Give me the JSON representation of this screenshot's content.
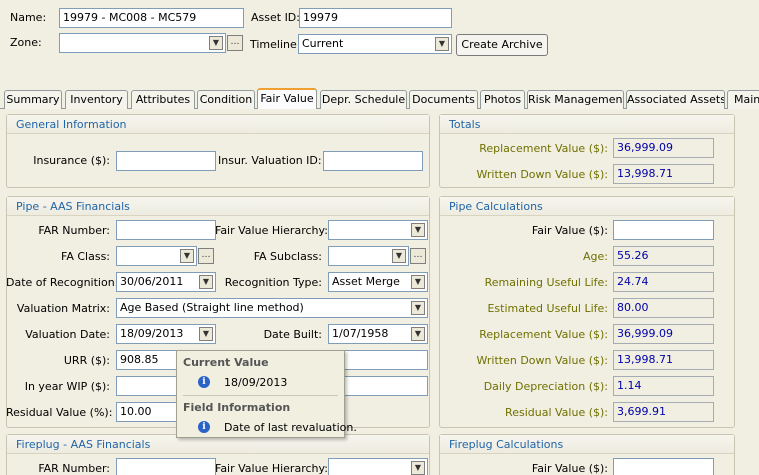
{
  "header": {
    "name_label": "Name:",
    "name_value": "19979 - MC008 - MC579",
    "asset_id_label": "Asset ID:",
    "asset_id_value": "19979",
    "zone_label": "Zone:",
    "zone_value": "",
    "timeline_label": "Timeline:",
    "timeline_value": "Current",
    "create_archive_label": "Create Archive"
  },
  "tabs": [
    {
      "label": "Summary"
    },
    {
      "label": "Inventory"
    },
    {
      "label": "Attributes"
    },
    {
      "label": "Condition"
    },
    {
      "label": "Fair Value",
      "active": true
    },
    {
      "label": "Depr. Schedule"
    },
    {
      "label": "Documents"
    },
    {
      "label": "Photos"
    },
    {
      "label": "Risk Management"
    },
    {
      "label": "Associated Assets"
    },
    {
      "label": "Maint"
    }
  ],
  "general_info": {
    "title": "General Information",
    "insurance_label": "Insurance ($):",
    "insurance_value": "",
    "insur_valuation_label": "Insur. Valuation ID:",
    "insur_valuation_value": ""
  },
  "totals": {
    "title": "Totals",
    "replacement_label": "Replacement Value ($):",
    "replacement_value": "36,999.09",
    "written_down_label": "Written Down Value ($):",
    "written_down_value": "13,998.71"
  },
  "pipe_financials": {
    "title": "Pipe - AAS Financials",
    "far_number_label": "FAR Number:",
    "far_number_value": "",
    "fv_hierarchy_label": "Fair Value Hierarchy:",
    "fv_hierarchy_value": "",
    "fa_class_label": "FA Class:",
    "fa_class_value": "",
    "fa_subclass_label": "FA Subclass:",
    "fa_subclass_value": "",
    "date_recognition_label": "Date of Recognition:",
    "date_recognition_value": "30/06/2011",
    "recognition_type_label": "Recognition Type:",
    "recognition_type_value": "Asset Merge",
    "valuation_matrix_label": "Valuation Matrix:",
    "valuation_matrix_value": "Age Based (Straight line method)",
    "valuation_date_label": "Valuation Date:",
    "valuation_date_value": "18/09/2013",
    "date_built_label": "Date Built:",
    "date_built_value": "1/07/1958",
    "urr_label": "URR ($):",
    "urr_value": "908.85",
    "in_year_wip_label": "In year WIP ($):",
    "in_year_wip_value": "",
    "residual_label": "Residual Value (%):",
    "residual_value": "10.00"
  },
  "pipe_calculations": {
    "title": "Pipe Calculations",
    "fair_value_label": "Fair Value ($):",
    "fair_value_value": "",
    "age_label": "Age:",
    "age_value": "55.26",
    "rul_label": "Remaining Useful Life:",
    "rul_value": "24.74",
    "eul_label": "Estimated Useful Life:",
    "eul_value": "80.00",
    "replacement_label": "Replacement Value ($):",
    "replacement_value": "36,999.09",
    "written_down_label": "Written Down Value ($):",
    "written_down_value": "13,998.71",
    "daily_dep_label": "Daily Depreciation ($):",
    "daily_dep_value": "1.14",
    "residual_label": "Residual Value ($):",
    "residual_value": "3,699.91"
  },
  "tooltip": {
    "current_value_heading": "Current Value",
    "current_value": "18/09/2013",
    "field_info_heading": "Field Information",
    "field_info": "Date of last revaluation."
  },
  "fireplug_financials": {
    "title": "Fireplug - AAS Financials",
    "far_number_label": "FAR Number:",
    "fv_hierarchy_label": "Fair Value Hierarchy:"
  },
  "fireplug_calculations": {
    "title": "Fireplug Calculations",
    "fair_value_label": "Fair Value ($):"
  },
  "colors": {
    "panel_title": "#1f64a8",
    "calc_label": "#707000",
    "readonly_value": "#0000aa",
    "active_tab_accent": "#f0a030"
  }
}
